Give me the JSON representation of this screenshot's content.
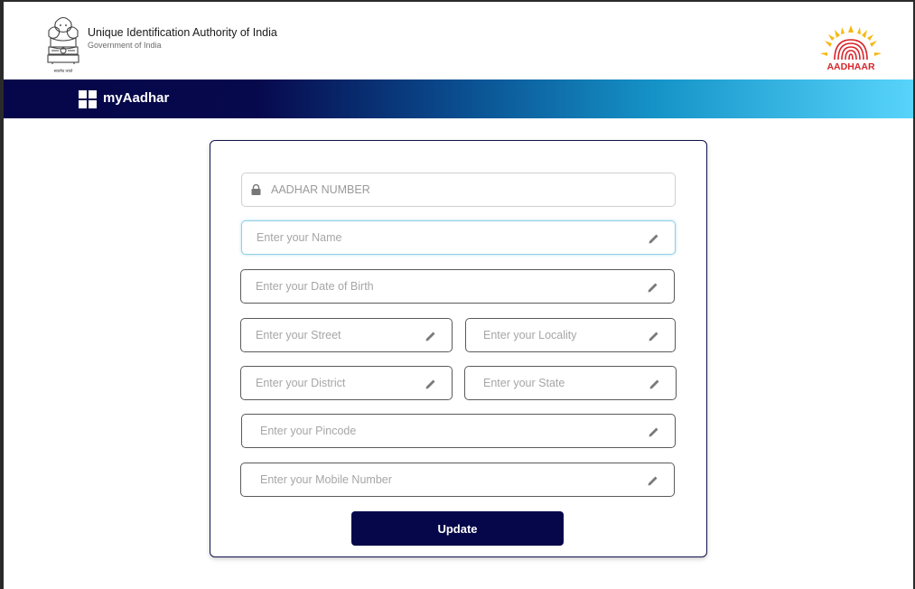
{
  "header": {
    "org_title": "Unique Identification Authority of India",
    "org_subtitle": "Government of India",
    "emblem_motto": "सत्यमेव जयते",
    "logo_text": "AADHAAR",
    "logo_icon": "aadhaar-fingerprint-sun-icon",
    "emblem_icon": "ashoka-emblem-icon"
  },
  "nav": {
    "title": "myAadhar",
    "icon": "grid-icon"
  },
  "form": {
    "aadhar_placeholder": "AADHAR NUMBER",
    "name_placeholder": "Enter your Name",
    "dob_placeholder": "Enter your Date of Birth",
    "street_placeholder": "Enter your Street",
    "locality_placeholder": "Enter your Locality",
    "district_placeholder": "Enter your District",
    "state_placeholder": "Enter your State",
    "pincode_placeholder": "Enter your Pincode",
    "mobile_placeholder": "Enter your Mobile Number",
    "submit_label": "Update"
  },
  "colors": {
    "navy": "#06064a",
    "gradient_end": "#58d4fb",
    "aadhaar_red": "#d7262b",
    "aadhaar_yellow": "#f5b914"
  }
}
